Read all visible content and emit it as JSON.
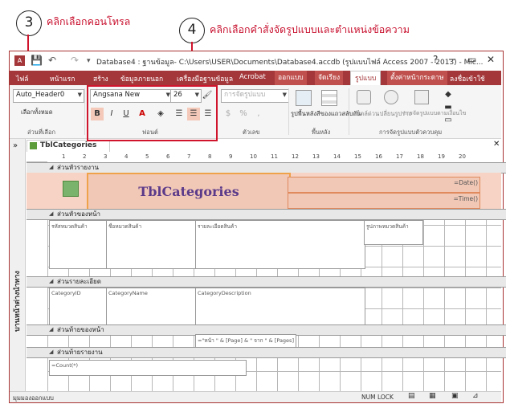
{
  "annotations": {
    "step3_number": "3",
    "step3_text": "คลิกเลือกคอนโทรล",
    "step4_number": "4",
    "step4_text": "คลิกเลือกคำสั่งจัดรูปแบบและตำแหน่งข้อความ"
  },
  "window": {
    "title": "Database4 : ฐานข้อมูล- C:\\Users\\USER\\Documents\\Database4.accdb (รูปแบบไฟล์ Access 2007 - 2013) - Mic...",
    "help": "?",
    "minimize": "─",
    "restore": "▭",
    "close": "✕"
  },
  "tabs": {
    "file": "ไฟล์",
    "home": "หน้าแรก",
    "create": "สร้าง",
    "external": "ข้อมูลภายนอก",
    "dbtools": "เครื่องมือฐานข้อมูล",
    "acrobat": "Acrobat",
    "design": "ออกแบบ",
    "arrange": "จัดเรียง",
    "format": "รูปแบบ",
    "pagesetup": "ตั้งค่าหน้ากระดาษ",
    "signin": "ลงชื่อเข้าใช้"
  },
  "ribbon": {
    "selection": {
      "object_combo": "Auto_Header0",
      "select_all": "เลือกทั้งหมด",
      "group_label": "ส่วนที่เลือก"
    },
    "font": {
      "font_name": "Angsana New",
      "font_size": "26",
      "bold": "B",
      "italic": "I",
      "underline": "U",
      "font_color": "A",
      "group_label": "ฟอนต์"
    },
    "number": {
      "format_combo": "การจัดรูปแบบ",
      "group_label": "ตัวเลข"
    },
    "background": {
      "bg_image": "รูปพื้นหลัง",
      "alt_row": "สีของแถวสลับกัน",
      "group_label": "พื้นหลัง"
    },
    "control_format": {
      "quick_styles": "สไตล์ด่วน",
      "change_shape": "เปลี่ยนรูปร่าง",
      "conditional": "การจัดรูปแบบตามเงื่อนไข",
      "group_label": "การจัดรูปแบบตัวควบคุม"
    }
  },
  "document": {
    "tab_title": "TblCategories",
    "nav_pane_label": "บานหน้าต่างนำทาง",
    "ruler_numbers": [
      "1",
      "2",
      "3",
      "4",
      "5",
      "6",
      "7",
      "8",
      "9",
      "10",
      "11",
      "12",
      "13",
      "14",
      "15",
      "16",
      "17",
      "18",
      "19",
      "20"
    ],
    "bands": {
      "report_header": "ส่วนหัวรายงาน",
      "page_header": "ส่วนหัวของหน้า",
      "detail": "ส่วนรายละเอียด",
      "page_footer": "ส่วนท้ายของหน้า",
      "report_footer": "ส่วนท้ายรายงาน"
    },
    "controls": {
      "title_label": "TblCategories",
      "date": "=Date()",
      "time": "=Time()",
      "lbl_id": "รหัสหมวดสินค้า",
      "lbl_name": "ชื่อหมวดสินค้า",
      "lbl_desc": "รายละเอียดสินค้า",
      "lbl_pic": "รูปภาพหมวดสินค้า",
      "txt_id": "CategoryID",
      "txt_name": "CategoryName",
      "txt_desc": "CategoryDescription",
      "page_expr": "=\"หน้า \" & [Page] & \" จาก \" & [Pages]",
      "count": "=Count(*)"
    }
  },
  "status": {
    "left": "มุมมองออกแบบ",
    "numlock": "NUM LOCK"
  }
}
